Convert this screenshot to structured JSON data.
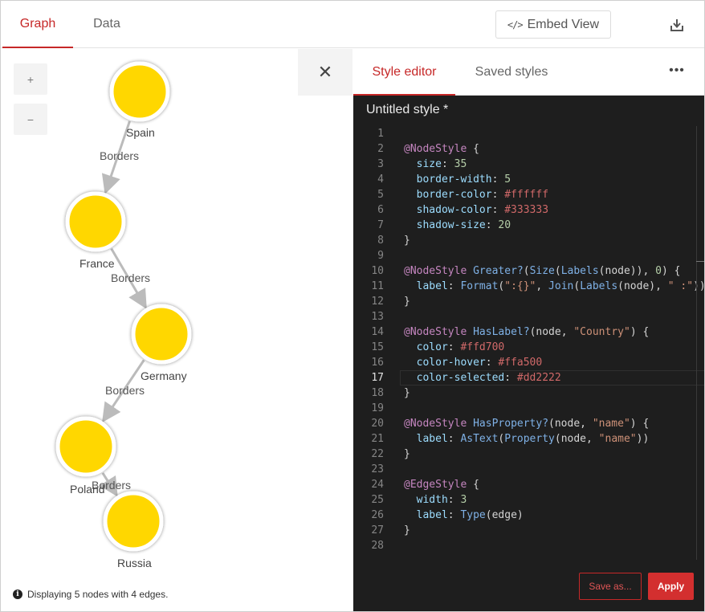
{
  "tabs": {
    "graph": "Graph",
    "data": "Data"
  },
  "toolbar": {
    "embed_icon": "</>",
    "embed_label": "Embed View",
    "download_icon": "download-icon"
  },
  "graph": {
    "zoom_in": "+",
    "zoom_out": "−",
    "close": "✕",
    "nodes": [
      "Spain",
      "France",
      "Germany",
      "Poland",
      "Russia"
    ],
    "edges": [
      "Borders",
      "Borders",
      "Borders",
      "Borders"
    ],
    "node_color": "#ffd700",
    "node_border": "#ffffff",
    "edge_color": "#bbbbbb",
    "status_icon": "i",
    "status": "Displaying 5 nodes with 4 edges."
  },
  "panel": {
    "tabs": [
      "Style editor",
      "Saved styles"
    ],
    "more": "•••",
    "style_name": "Untitled style *",
    "save_as": "Save as...",
    "apply": "Apply",
    "active_line": 17,
    "code": [
      "",
      "@NodeStyle {",
      "  size: 35",
      "  border-width: 5",
      "  border-color: #ffffff",
      "  shadow-color: #333333",
      "  shadow-size: 20",
      "}",
      "",
      "@NodeStyle Greater?(Size(Labels(node)), 0) {",
      "  label: Format(\":{}\", Join(Labels(node), \" :\"))",
      "}",
      "",
      "@NodeStyle HasLabel?(node, \"Country\") {",
      "  color: #ffd700",
      "  color-hover: #ffa500",
      "  color-selected: #dd2222",
      "}",
      "",
      "@NodeStyle HasProperty?(node, \"name\") {",
      "  label: AsText(Property(node, \"name\"))",
      "}",
      "",
      "@EdgeStyle {",
      "  width: 3",
      "  label: Type(edge)",
      "}",
      ""
    ]
  },
  "colors": {
    "accent": "#c62828",
    "editor_bg": "#1e1e1e"
  }
}
